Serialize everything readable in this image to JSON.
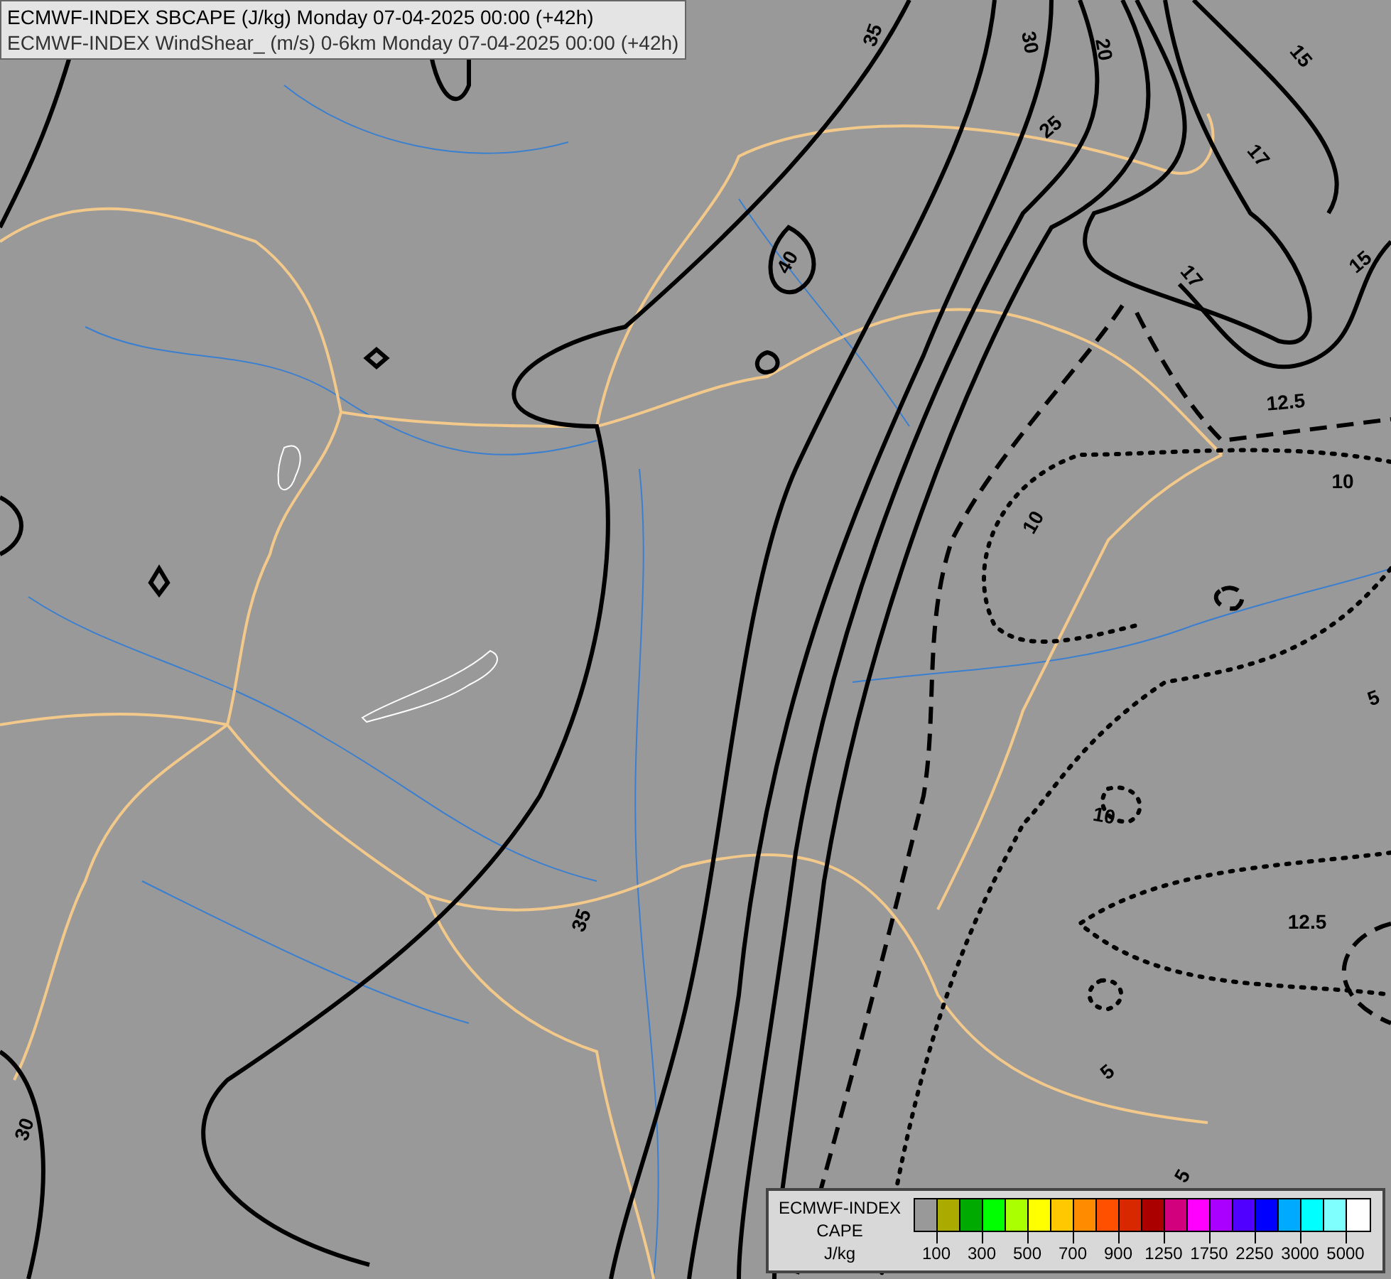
{
  "header": {
    "lines": [
      "ECMWF-INDEX SBCAPE (J/kg) Monday 07-04-2025 00:00 (+42h)",
      "ECMWF-INDEX WindShear_ (m/s) 0-6km Monday 07-04-2025 00:00 (+42h)"
    ]
  },
  "map": {
    "contour_labels": [
      "35",
      "30",
      "20",
      "15",
      "25",
      "17",
      "40",
      "17",
      "15",
      "12.5",
      "10",
      "10",
      "5",
      "10",
      "35",
      "12.5",
      "5",
      "30",
      "5"
    ]
  },
  "legend": {
    "title_lines": [
      "ECMWF-INDEX",
      "CAPE",
      "J/kg"
    ],
    "swatches": [
      {
        "color": "#999999"
      },
      {
        "color": "#aaaa00"
      },
      {
        "color": "#00aa00"
      },
      {
        "color": "#00ff00"
      },
      {
        "color": "#aaff00"
      },
      {
        "color": "#ffff00"
      },
      {
        "color": "#ffc800"
      },
      {
        "color": "#ff8c00"
      },
      {
        "color": "#ff5000"
      },
      {
        "color": "#d72800"
      },
      {
        "color": "#aa0000"
      },
      {
        "color": "#d2007d"
      },
      {
        "color": "#ff00ff"
      },
      {
        "color": "#aa00ff"
      },
      {
        "color": "#5000ff"
      },
      {
        "color": "#0000ff"
      },
      {
        "color": "#00aaff"
      },
      {
        "color": "#00ffff"
      },
      {
        "color": "#80ffff"
      },
      {
        "color": "#ffffff"
      }
    ],
    "tick_labels": [
      "100",
      "300",
      "500",
      "700",
      "900",
      "1250",
      "1750",
      "2250",
      "3000",
      "5000"
    ]
  }
}
